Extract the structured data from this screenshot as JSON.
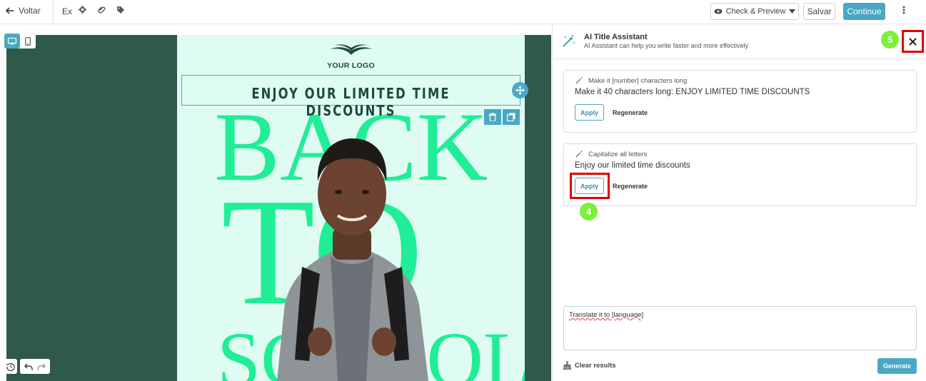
{
  "topbar": {
    "back_label": "Voltar",
    "email_name": "Ex",
    "check_preview_label": "Check & Preview",
    "save_label": "Salvar",
    "continue_label": "Continue"
  },
  "email": {
    "logo_text": "YOUR LOGO",
    "heading": "ENJOY OUR LIMITED TIME DISCOUNTS",
    "hero_word_1": "BACK",
    "hero_word_2": "TO",
    "hero_word_3": "SCHOOL"
  },
  "panel": {
    "title": "AI Title Assistant",
    "subtitle": "AI Assistant can help you write faster and more effectively",
    "suggestions": [
      {
        "label": "Make it [number] characters long",
        "text": "Make it 40 characters long: ENJOY LIMITED TIME DISCOUNTS",
        "apply_label": "Apply",
        "regenerate_label": "Regenerate"
      },
      {
        "label": "Capitalize all letters",
        "text": "Enjoy our limited time discounts",
        "apply_label": "Apply",
        "regenerate_label": "Regenerate"
      }
    ],
    "prompt_value": "Translate it to [language]",
    "clear_results_label": "Clear results",
    "generate_label": "Generate"
  },
  "annotations": {
    "step_4": "4",
    "step_5": "5",
    "highlight_color": "#e10000",
    "badge_color": "#7cf03a"
  },
  "colors": {
    "accent": "#4aa8c4",
    "canvas_bg": "#2f5a4b",
    "email_bg": "#dffcf2",
    "hero_green": "#1fee96",
    "dark_green": "#1d4a3d"
  }
}
